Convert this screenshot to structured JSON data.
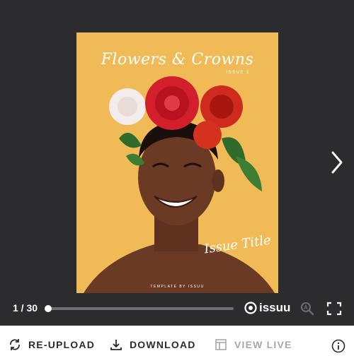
{
  "cover": {
    "title": "Flowers & Crowns",
    "issue": "ISSUE 1",
    "issue_title": "Issue Title",
    "template_credit": "TEMPLATE BY ISSUU"
  },
  "viewer": {
    "page_counter": "1 / 30",
    "current_page": 1,
    "total_pages": 30,
    "brand": "issuu",
    "next_icon": "chevron-right-icon",
    "zoom_icon": "zoom-icon",
    "fullscreen_icon": "fullscreen-icon"
  },
  "actions": {
    "reupload": {
      "label": "RE-UPLOAD",
      "icon": "refresh-icon"
    },
    "download": {
      "label": "DOWNLOAD",
      "icon": "download-icon"
    },
    "view_live": {
      "label": "VIEW LIVE",
      "icon": "layout-icon"
    },
    "info_icon": "info-icon"
  },
  "colors": {
    "viewer_bg": "#2c2b2d",
    "cover_bg": "#f0bb57",
    "accent_red": "#d21f2b"
  }
}
